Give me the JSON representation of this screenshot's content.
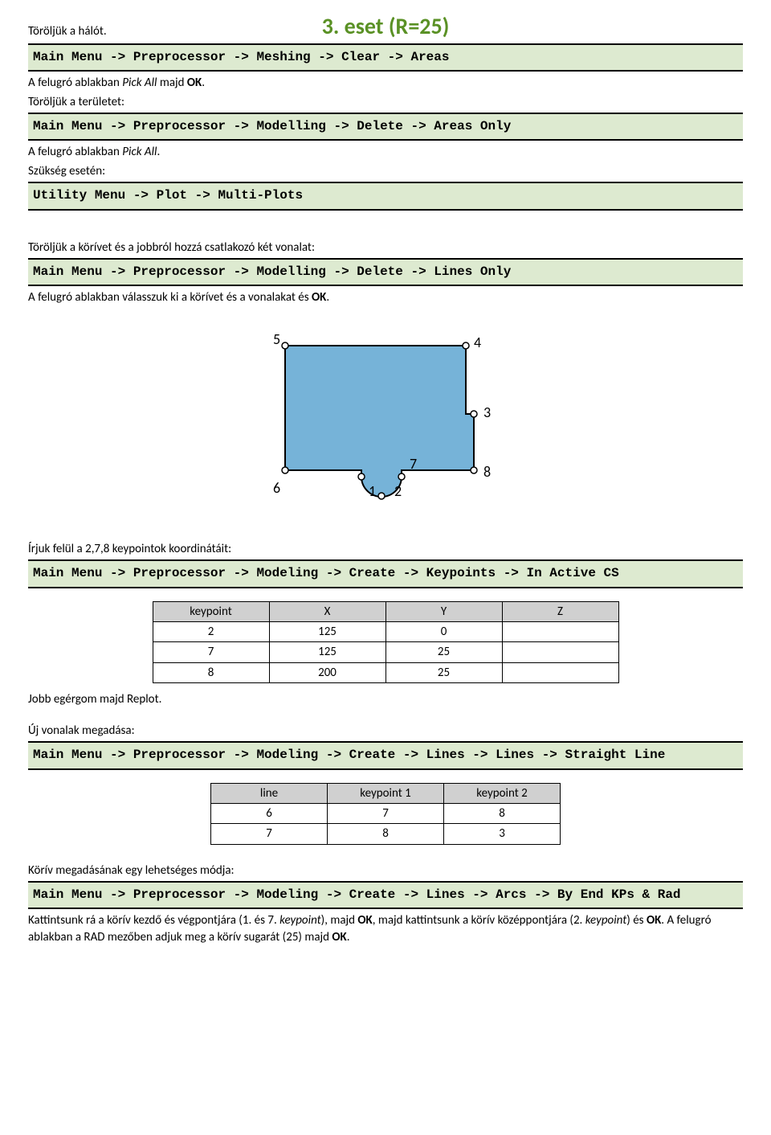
{
  "title": "3. eset (R=25)",
  "p1": "Töröljük a hálót.",
  "cmd1": "Main Menu -> Preprocessor -> Meshing -> Clear -> Areas",
  "p2_a": "A felugró ablakban ",
  "p2_b": "Pick All",
  "p2_c": " majd ",
  "p2_d": "OK",
  "p2_e": ".",
  "p3": "Töröljük a területet:",
  "cmd2": "Main Menu -> Preprocessor -> Modelling -> Delete -> Areas Only",
  "p4_a": "A felugró ablakban ",
  "p4_b": "Pick All",
  "p4_c": ".",
  "p5": "Szükség esetén:",
  "cmd3": "Utility Menu -> Plot -> Multi-Plots",
  "p6": "Töröljük a körívet és a jobbról hozzá csatlakozó két vonalat:",
  "cmd4": "Main Menu -> Preprocessor -> Modelling -> Delete -> Lines Only",
  "p7_a": "A felugró ablakban válasszuk ki a körívet és a vonalakat és ",
  "p7_b": "OK",
  "p7_c": ".",
  "fig": {
    "labels": {
      "k1": "1",
      "k2": "2",
      "k3": "3",
      "k4": "4",
      "k5": "5",
      "k6": "6",
      "k7": "7",
      "k8": "8"
    }
  },
  "p8": "Írjuk felül a 2,7,8 keypointok koordinátáit:",
  "cmd5": "Main Menu -> Preprocessor -> Modeling -> Create -> Keypoints -> In Active CS",
  "tableA": {
    "head": {
      "c1": "keypoint",
      "c2": "X",
      "c3": "Y",
      "c4": "Z"
    },
    "rows": [
      {
        "c1": "2",
        "c2": "125",
        "c3": "0",
        "c4": ""
      },
      {
        "c1": "7",
        "c2": "125",
        "c3": "25",
        "c4": ""
      },
      {
        "c1": "8",
        "c2": "200",
        "c3": "25",
        "c4": ""
      }
    ]
  },
  "p9": "Jobb egérgom majd Replot.",
  "p10": "Új vonalak  megadása:",
  "cmd6": "Main Menu -> Preprocessor -> Modeling -> Create -> Lines -> Lines -> Straight Line",
  "tableB": {
    "head": {
      "c1": "line",
      "c2": "keypoint 1",
      "c3": "keypoint 2"
    },
    "rows": [
      {
        "c1": "6",
        "c2": "7",
        "c3": "8"
      },
      {
        "c1": "7",
        "c2": "8",
        "c3": "3"
      }
    ]
  },
  "p11": "Körív  megadásának egy lehetséges módja:",
  "cmd7": "Main Menu -> Preprocessor -> Modeling -> Create -> Lines -> Arcs -> By End KPs & Rad",
  "p12_a": "Kattintsunk rá a körív kezdő és végpontjára (1. és 7. ",
  "p12_b": "keypoint",
  "p12_c": "), majd ",
  "p12_d": "OK",
  "p12_e": ", majd kattintsunk a körív középpontjára (2. ",
  "p12_f": "keypoint",
  "p12_g": ") és ",
  "p12_h": "OK",
  "p12_i": ". A felugró ablakban a RAD mezőben adjuk meg a körív sugarát (25) majd ",
  "p12_j": "OK",
  "p12_k": "."
}
